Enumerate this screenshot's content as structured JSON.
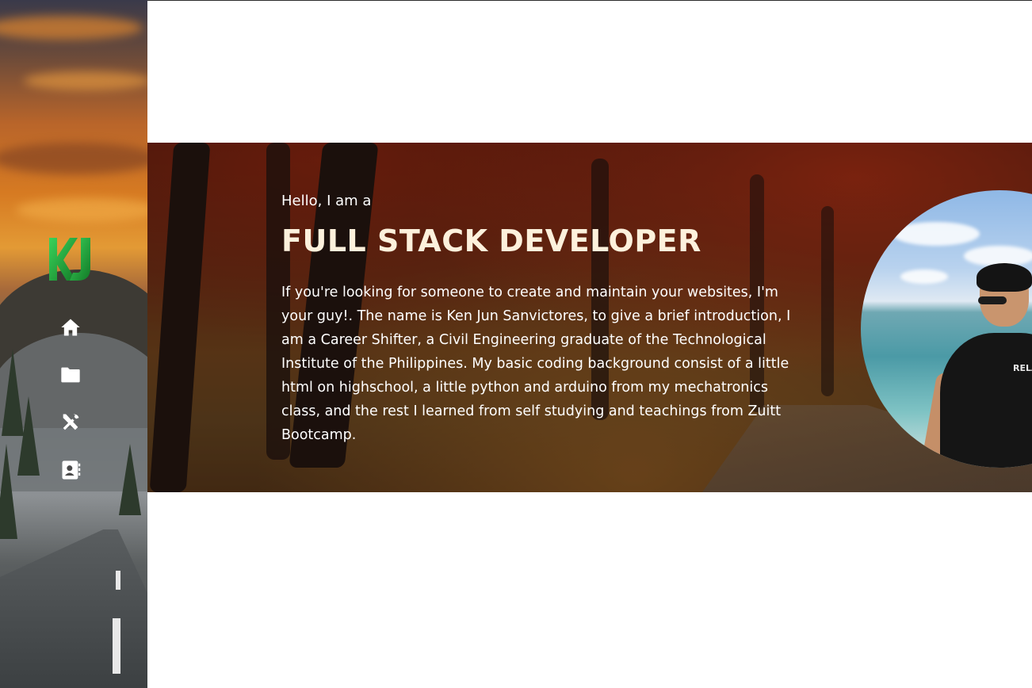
{
  "sidebar": {
    "logo_text": "KJ",
    "nav": [
      {
        "name": "home",
        "icon": "home-icon"
      },
      {
        "name": "projects",
        "icon": "folder-icon"
      },
      {
        "name": "skills",
        "icon": "tools-icon"
      },
      {
        "name": "contact",
        "icon": "contact-card-icon"
      }
    ]
  },
  "hero": {
    "intro": "Hello, I am a",
    "title": "FULL STACK DEVELOPER",
    "description": "If you're looking for someone to create and maintain your websites, I'm your guy!. The name is Ken Jun Sanvictores, to give a brief introduction, I am a Career Shifter, a Civil Engineering graduate of the Technological Institute of the Philippines. My basic coding background consist of a little html on highschool, a little python and arduino from my mechatronics class, and the rest I learned from self studying and teachings from Zuitt Bootcamp.",
    "shirt_print": "RELA"
  },
  "colors": {
    "logo_green": "#1fa33a",
    "title_color": "#fdf1dc",
    "nav_icon": "#ffffff"
  }
}
